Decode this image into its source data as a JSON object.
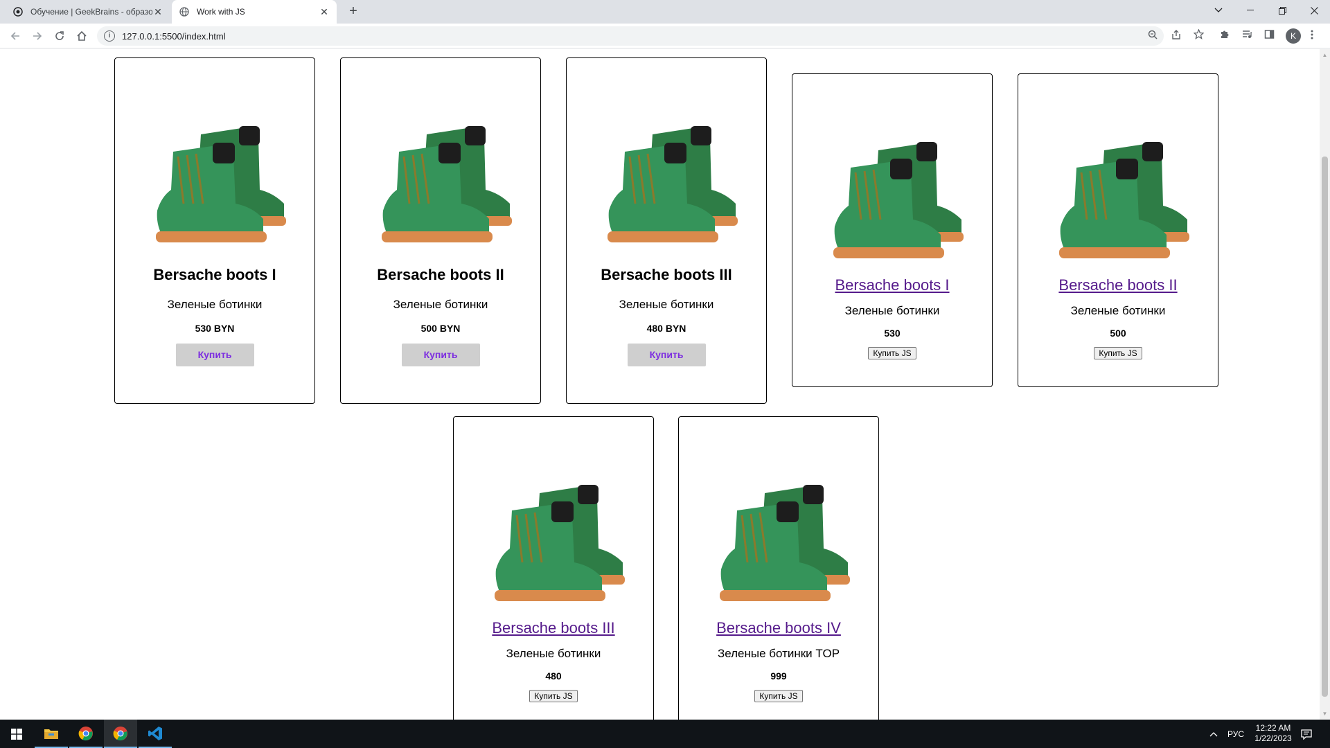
{
  "browser": {
    "tabs": [
      {
        "title": "Обучение | GeekBrains - образо",
        "active": false
      },
      {
        "title": "Work with JS",
        "active": true
      }
    ],
    "new_tab_symbol": "+",
    "close_symbol": "✕",
    "url": "127.0.0.1:5500/index.html",
    "profile_initial": "K"
  },
  "static_cards": [
    {
      "title": "Bersache boots I",
      "description": "Зеленые ботинки",
      "price": "530 BYN",
      "button": "Купить"
    },
    {
      "title": "Bersache boots II",
      "description": "Зеленые ботинки",
      "price": "500 BYN",
      "button": "Купить"
    },
    {
      "title": "Bersache boots III",
      "description": "Зеленые ботинки",
      "price": "480 BYN",
      "button": "Купить"
    }
  ],
  "js_cards": [
    {
      "title": "Bersache boots I",
      "description": "Зеленые ботинки",
      "price": "530",
      "button": "Купить JS"
    },
    {
      "title": "Bersache boots II",
      "description": "Зеленые ботинки",
      "price": "500",
      "button": "Купить JS"
    },
    {
      "title": "Bersache boots III",
      "description": "Зеленые ботинки",
      "price": "480",
      "button": "Купить JS"
    },
    {
      "title": "Bersache boots IV",
      "description": "Зеленые ботинки TOP",
      "price": "999",
      "button": "Купить JS"
    }
  ],
  "taskbar": {
    "language": "РУС",
    "time": "12:22 AM",
    "date": "1/22/2023"
  },
  "colors": {
    "boot_green": "#2f8a4c",
    "boot_sole": "#d88a4a",
    "link_visited": "#551a8b",
    "buy_text": "#7d2ee0"
  }
}
